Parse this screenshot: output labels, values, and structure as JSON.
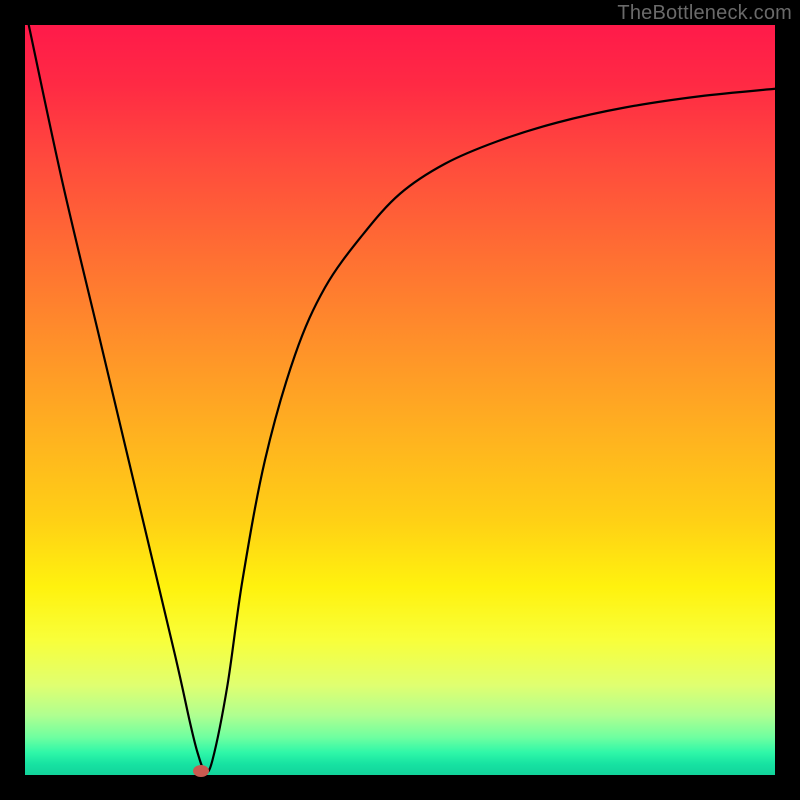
{
  "watermark": "TheBottleneck.com",
  "chart_data": {
    "type": "line",
    "title": "",
    "xlabel": "",
    "ylabel": "",
    "xlim": [
      0,
      100
    ],
    "ylim": [
      0,
      100
    ],
    "grid": false,
    "legend": false,
    "series": [
      {
        "name": "curve",
        "x": [
          0.5,
          5,
          10,
          15,
          20,
          22,
          23,
          24,
          25,
          27,
          29,
          32,
          36,
          40,
          45,
          50,
          56,
          63,
          71,
          80,
          90,
          100
        ],
        "y": [
          100,
          79,
          58,
          37,
          16,
          7,
          3,
          0.5,
          2,
          12,
          26,
          42,
          56,
          65,
          72,
          77.5,
          81.5,
          84.5,
          87,
          89,
          90.5,
          91.5
        ]
      }
    ],
    "marker": {
      "x": 23.5,
      "y": 0.5,
      "color": "#c95a50"
    },
    "gradient_colors": {
      "top": "#ff1a4a",
      "mid": "#ffd015",
      "bottom": "#12d39b"
    }
  }
}
